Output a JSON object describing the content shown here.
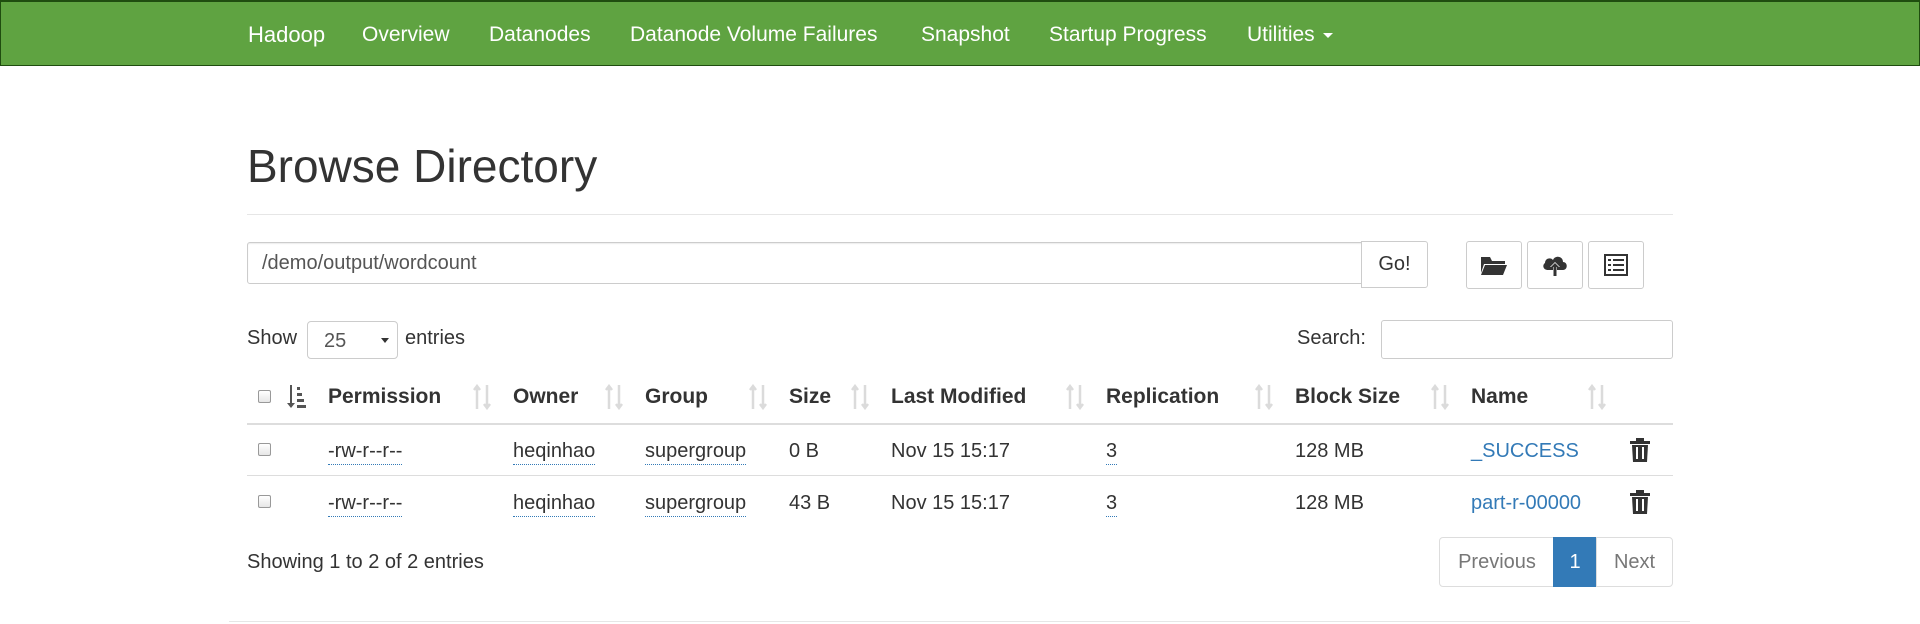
{
  "navbar": {
    "brand": "Hadoop",
    "items": [
      "Overview",
      "Datanodes",
      "Datanode Volume Failures",
      "Snapshot",
      "Startup Progress",
      "Utilities"
    ]
  },
  "page_title": "Browse Directory",
  "path_bar": {
    "value": "/demo/output/wordcount",
    "go_label": "Go!",
    "tool_icons": [
      "folder-open-icon",
      "cloud-upload-icon",
      "list-alt-icon"
    ]
  },
  "table_controls": {
    "show_label": "Show",
    "entries_value": "25",
    "entries_label": "entries",
    "search_label": "Search:",
    "search_value": ""
  },
  "table": {
    "columns": [
      "Permission",
      "Owner",
      "Group",
      "Size",
      "Last Modified",
      "Replication",
      "Block Size",
      "Name"
    ],
    "rows": [
      {
        "permission": "-rw-r--r--",
        "owner": "heqinhao",
        "group": "supergroup",
        "size": "0 B",
        "last_modified": "Nov 15 15:17",
        "replication": "3",
        "block_size": "128 MB",
        "name": "_SUCCESS"
      },
      {
        "permission": "-rw-r--r--",
        "owner": "heqinhao",
        "group": "supergroup",
        "size": "43 B",
        "last_modified": "Nov 15 15:17",
        "replication": "3",
        "block_size": "128 MB",
        "name": "part-r-00000"
      }
    ]
  },
  "footer": {
    "info": "Showing 1 to 2 of 2 entries",
    "previous": "Previous",
    "page": "1",
    "next": "Next"
  },
  "colors": {
    "navbar_bg": "#5fa341",
    "link": "#337ab7",
    "active_page": "#337ab7"
  }
}
